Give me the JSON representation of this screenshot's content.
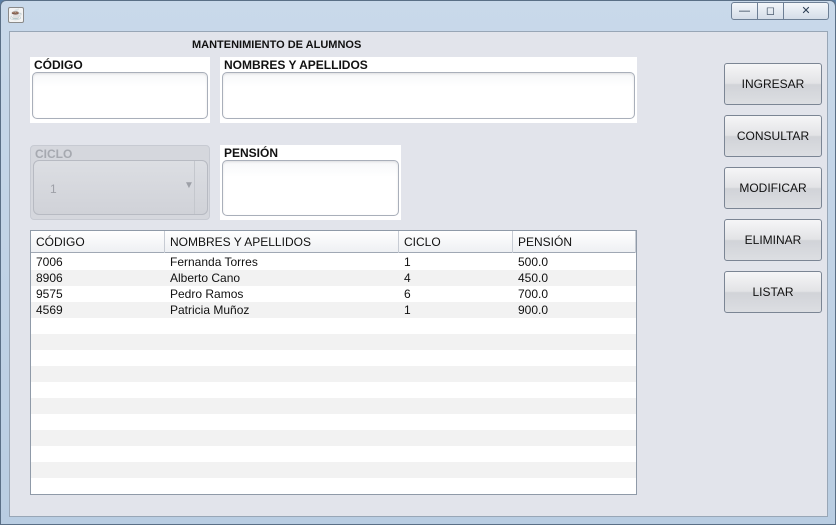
{
  "window": {
    "icon": "java-cup-icon",
    "controls": {
      "minimize": "—",
      "maximize": "◻",
      "close": "✕"
    }
  },
  "form": {
    "heading": "MANTENIMIENTO DE ALUMNOS",
    "codigo": {
      "label": "CÓDIGO",
      "value": ""
    },
    "nombres": {
      "label": "NOMBRES Y APELLIDOS",
      "value": ""
    },
    "ciclo": {
      "label": "CICLO",
      "selected": "1",
      "arrow": "▼"
    },
    "pension": {
      "label": "PENSIÓN",
      "value": ""
    }
  },
  "table": {
    "columns": [
      "CÓDIGO",
      "NOMBRES Y APELLIDOS",
      "CICLO",
      "PENSIÓN"
    ],
    "rows": [
      [
        "7006",
        "Fernanda Torres",
        "1",
        "500.0"
      ],
      [
        "8906",
        "Alberto Cano",
        "4",
        "450.0"
      ],
      [
        "9575",
        "Pedro Ramos",
        "6",
        "700.0"
      ],
      [
        "4569",
        "Patricia Muñoz",
        "1",
        "900.0"
      ],
      [
        "",
        "",
        "",
        ""
      ],
      [
        "",
        "",
        "",
        ""
      ],
      [
        "",
        "",
        "",
        ""
      ],
      [
        "",
        "",
        "",
        ""
      ],
      [
        "",
        "",
        "",
        ""
      ],
      [
        "",
        "",
        "",
        ""
      ],
      [
        "",
        "",
        "",
        ""
      ],
      [
        "",
        "",
        "",
        ""
      ],
      [
        "",
        "",
        "",
        ""
      ],
      [
        "",
        "",
        "",
        ""
      ],
      [
        "",
        "",
        "",
        ""
      ]
    ]
  },
  "buttons": {
    "ingresar": "INGRESAR",
    "consultar": "CONSULTAR",
    "modificar": "MODIFICAR",
    "eliminar": "ELIMINAR",
    "listar": "LISTAR"
  }
}
